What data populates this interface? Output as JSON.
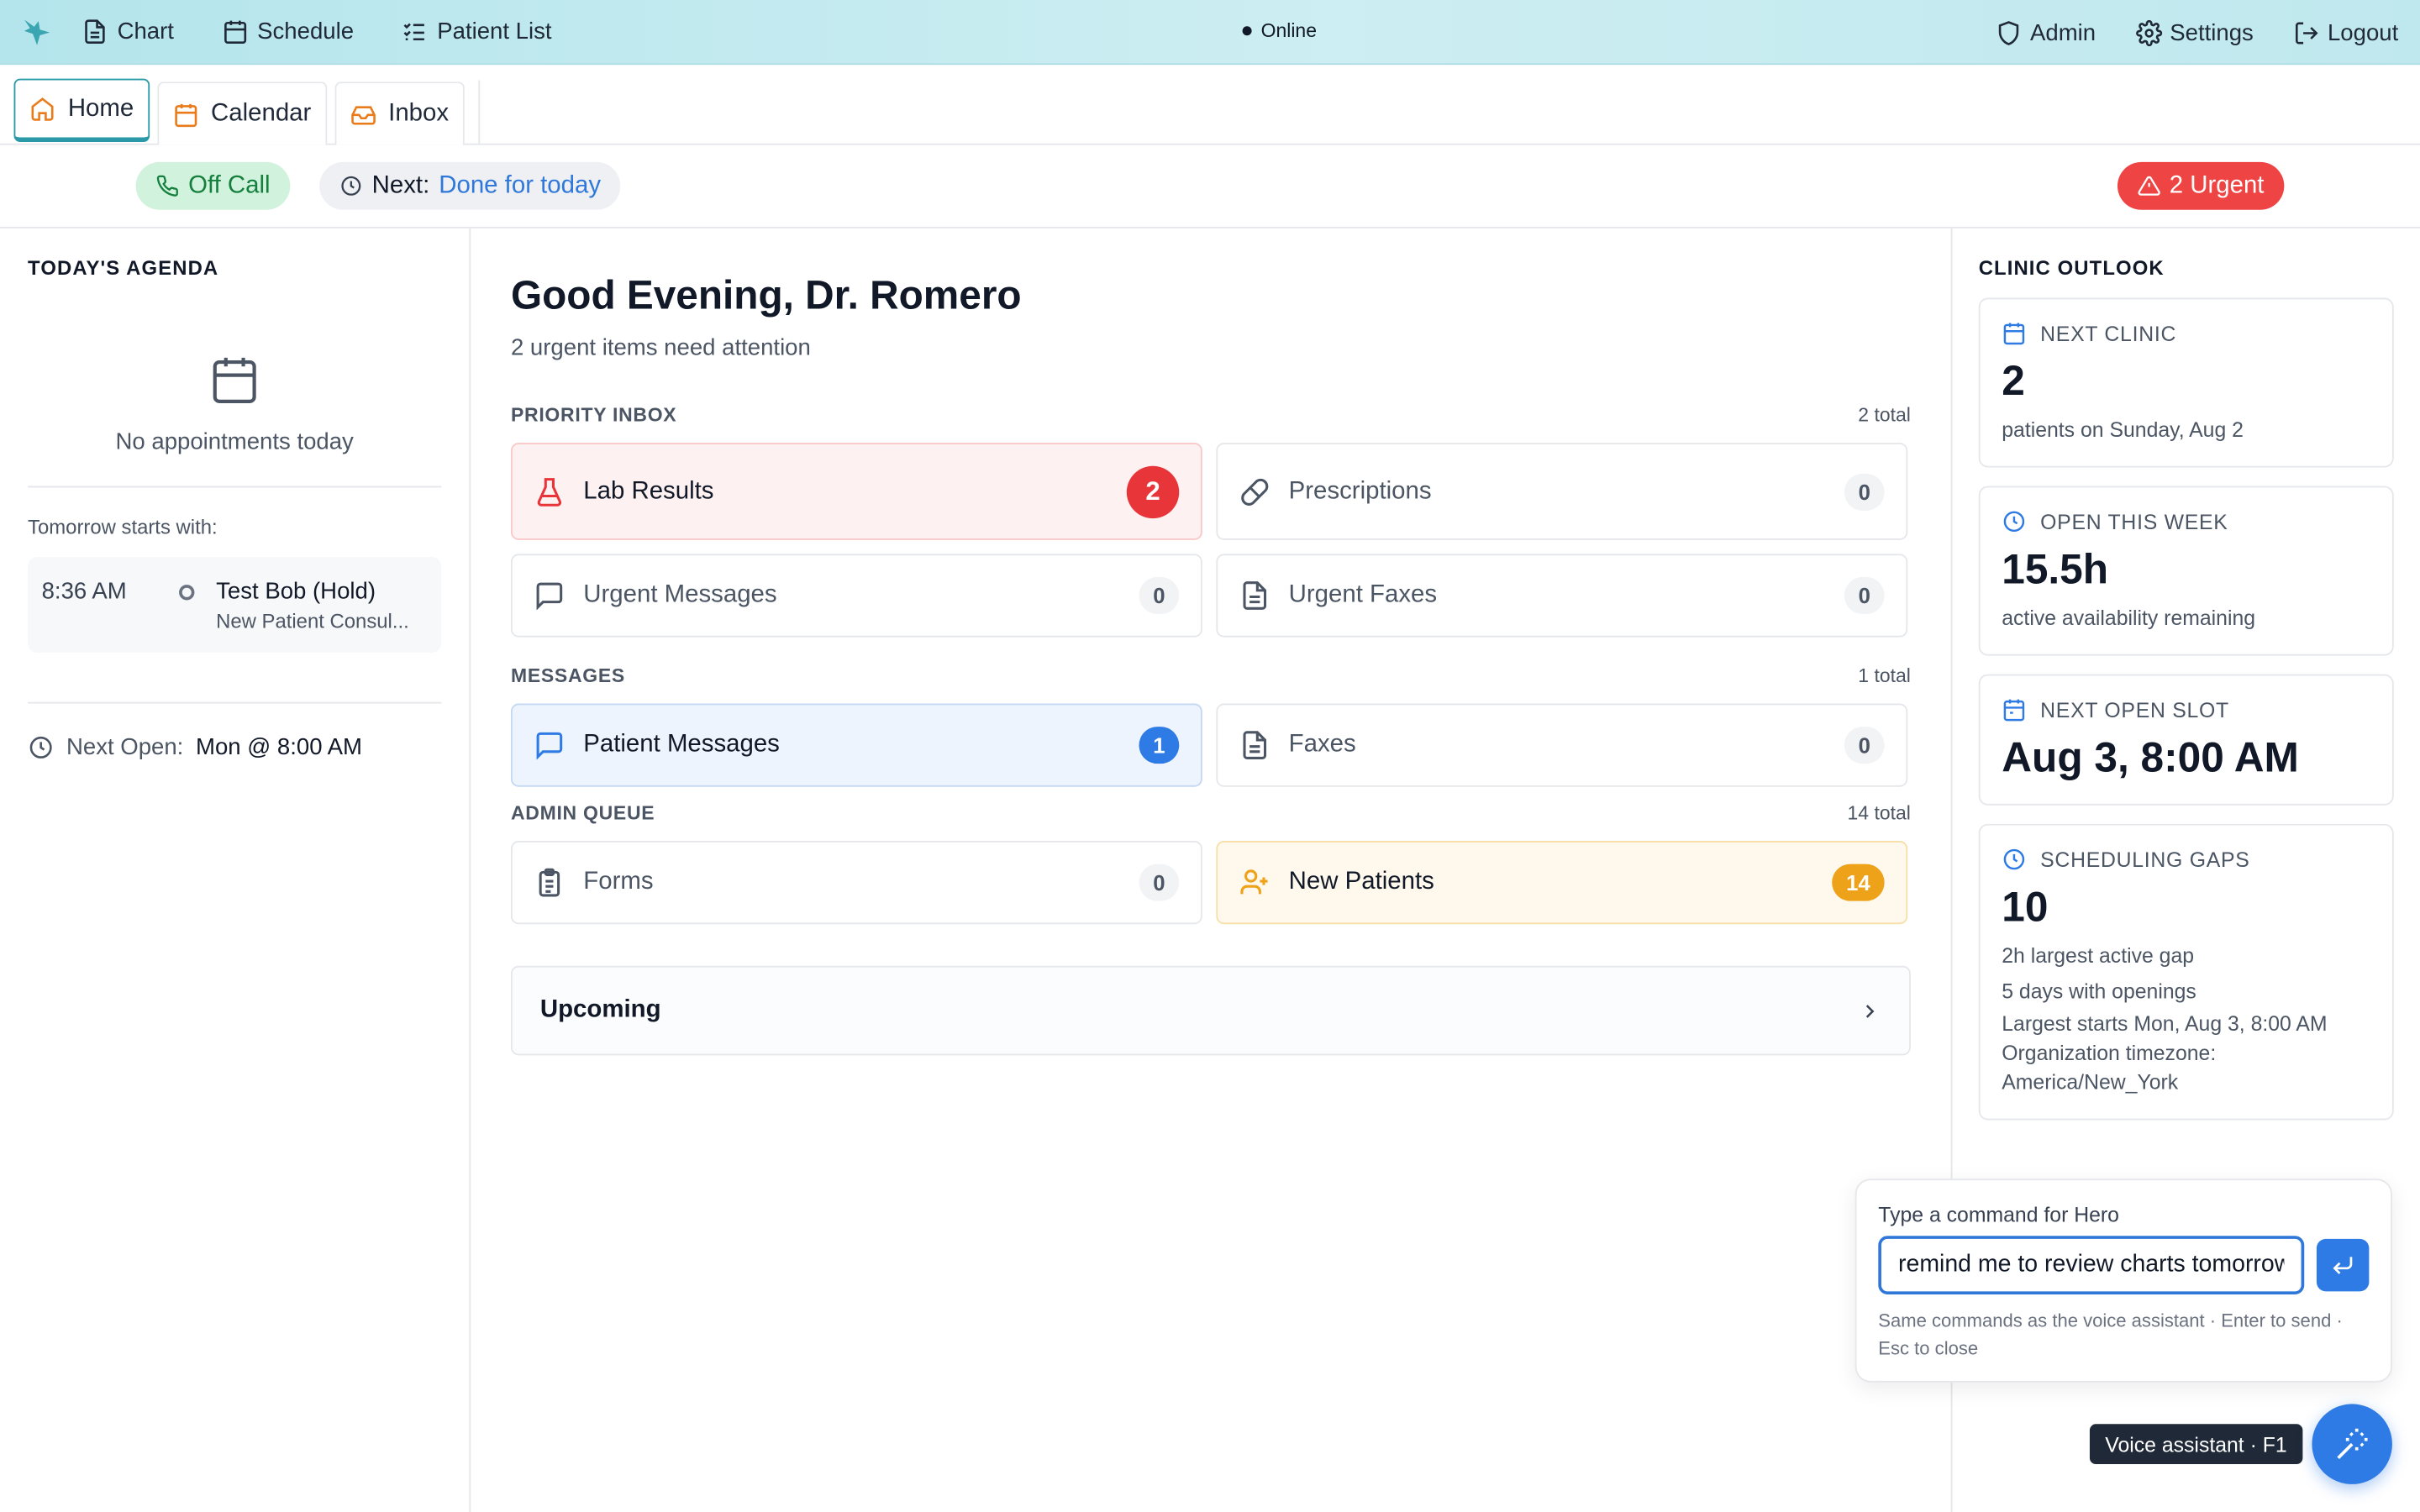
{
  "nav": {
    "items": [
      {
        "label": "Chart",
        "icon": "document-icon"
      },
      {
        "label": "Schedule",
        "icon": "calendar-icon"
      },
      {
        "label": "Patient List",
        "icon": "list-check-icon"
      }
    ],
    "status": "Online",
    "right": [
      {
        "label": "Admin",
        "icon": "shield-icon"
      },
      {
        "label": "Settings",
        "icon": "gear-icon"
      },
      {
        "label": "Logout",
        "icon": "logout-icon"
      }
    ]
  },
  "tabs": [
    {
      "label": "Home",
      "icon": "home-icon",
      "active": true
    },
    {
      "label": "Calendar",
      "icon": "calendar-icon",
      "active": false
    },
    {
      "label": "Inbox",
      "icon": "inbox-icon",
      "active": false
    }
  ],
  "status": {
    "call": "Off Call",
    "next_label": "Next:",
    "next_value": "Done for today",
    "urgent": "2 Urgent"
  },
  "agenda": {
    "title": "TODAY'S AGENDA",
    "empty": "No appointments today",
    "tomorrow_label": "Tomorrow starts with:",
    "appt_time": "8:36 AM",
    "appt_name": "Test Bob (Hold)",
    "appt_desc": "New Patient Consul...",
    "next_open_label": "Next Open:",
    "next_open_value": "Mon @ 8:00 AM"
  },
  "main": {
    "greeting": "Good Evening, Dr. Romero",
    "subtitle": "2 urgent items need attention",
    "groups": [
      {
        "title": "PRIORITY INBOX",
        "count": "2 total",
        "cards": [
          {
            "label": "Lab Results",
            "value": "2",
            "icon": "flask-icon"
          },
          {
            "label": "Prescriptions",
            "value": "0",
            "icon": "pill-icon"
          },
          {
            "label": "Urgent Messages",
            "value": "0",
            "icon": "message-icon"
          },
          {
            "label": "Urgent Faxes",
            "value": "0",
            "icon": "file-icon"
          }
        ]
      },
      {
        "title": "MESSAGES",
        "count": "1 total",
        "cards": [
          {
            "label": "Patient Messages",
            "value": "1",
            "icon": "message-icon"
          },
          {
            "label": "Faxes",
            "value": "0",
            "icon": "file-icon"
          }
        ]
      },
      {
        "title": "ADMIN QUEUE",
        "count": "14 total",
        "cards": [
          {
            "label": "Forms",
            "value": "0",
            "icon": "clipboard-icon"
          },
          {
            "label": "New Patients",
            "value": "14",
            "icon": "user-plus-icon"
          }
        ]
      }
    ],
    "upcoming": "Upcoming"
  },
  "outlook": {
    "title": "CLINIC OUTLOOK",
    "cards": [
      {
        "label": "NEXT CLINIC",
        "value": "2",
        "lines": [
          "patients on Sunday, Aug 2"
        ],
        "icon": "calendar-icon"
      },
      {
        "label": "OPEN THIS WEEK",
        "value": "15.5h",
        "lines": [
          "active availability remaining"
        ],
        "icon": "clock-icon"
      },
      {
        "label": "NEXT OPEN SLOT",
        "value": "Aug 3, 8:00 AM",
        "lines": [],
        "icon": "calendar-icon"
      },
      {
        "label": "SCHEDULING GAPS",
        "value": "10",
        "lines": [
          "2h largest active gap",
          "5 days with openings",
          "Largest starts Mon, Aug 3, 8:00 AM",
          "Organization timezone: America/New_York"
        ],
        "icon": "clock-icon"
      }
    ]
  },
  "command": {
    "label": "Type a command for Hero",
    "value": "remind me to review charts tomorrow",
    "hint": "Same commands as the voice assistant · Enter to send · Esc to close"
  },
  "voice": {
    "tooltip": "Voice assistant · F1"
  },
  "colors": {
    "accent": "#2a9aa8",
    "blue": "#2f7be5",
    "red": "#e8353a",
    "amber": "#eea21a",
    "green": "#15803d"
  }
}
